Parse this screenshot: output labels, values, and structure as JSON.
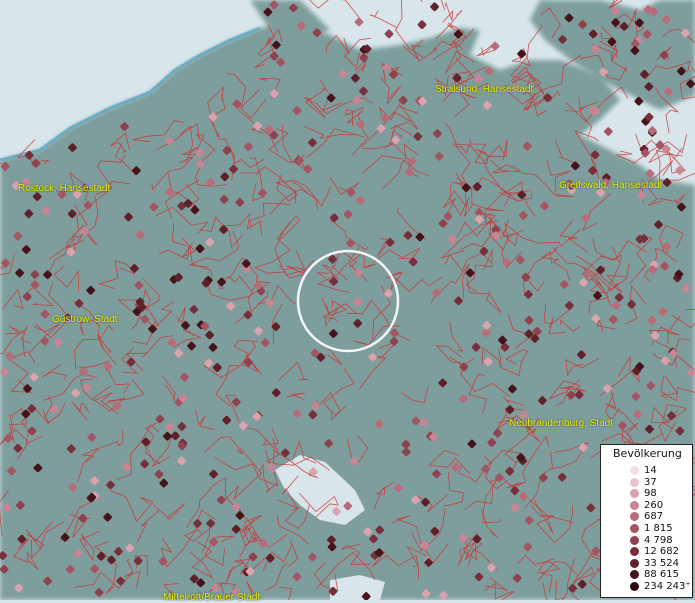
{
  "map": {
    "cities": [
      {
        "id": "stralsund",
        "name": "Stralsund, Hansestadt"
      },
      {
        "id": "rostock",
        "name": "Rostock, Hansestadt"
      },
      {
        "id": "greifswald",
        "name": "Greifswald, Hansestadt"
      },
      {
        "id": "guestrow",
        "name": "Güstrow, Stadt"
      },
      {
        "id": "neubrandenburg",
        "name": "Neubrandenburg, Stadt"
      },
      {
        "id": "mueritz",
        "name": "Mittelrott/Brauer Stadt"
      }
    ],
    "colors": {
      "water": "#d8e6ec",
      "land": "#7e9e9d",
      "boundary": "#cc3333",
      "label": "#f3f000",
      "highlight_ring": "#ffffff"
    }
  },
  "legend": {
    "title": "Bevölkerung",
    "items": [
      {
        "label": "14",
        "color": "#f4dde5"
      },
      {
        "label": "37",
        "color": "#e9c2cd"
      },
      {
        "label": "98",
        "color": "#d9a3b0"
      },
      {
        "label": "260",
        "color": "#c88593"
      },
      {
        "label": "687",
        "color": "#b86b79"
      },
      {
        "label": "1 815",
        "color": "#a45563"
      },
      {
        "label": "4 798",
        "color": "#8e414e"
      },
      {
        "label": "12 682",
        "color": "#76303b"
      },
      {
        "label": "33 524",
        "color": "#5e212a"
      },
      {
        "label": "88 615",
        "color": "#45141b"
      },
      {
        "label": "234 243⁺",
        "color": "#2b0a0e"
      }
    ]
  }
}
